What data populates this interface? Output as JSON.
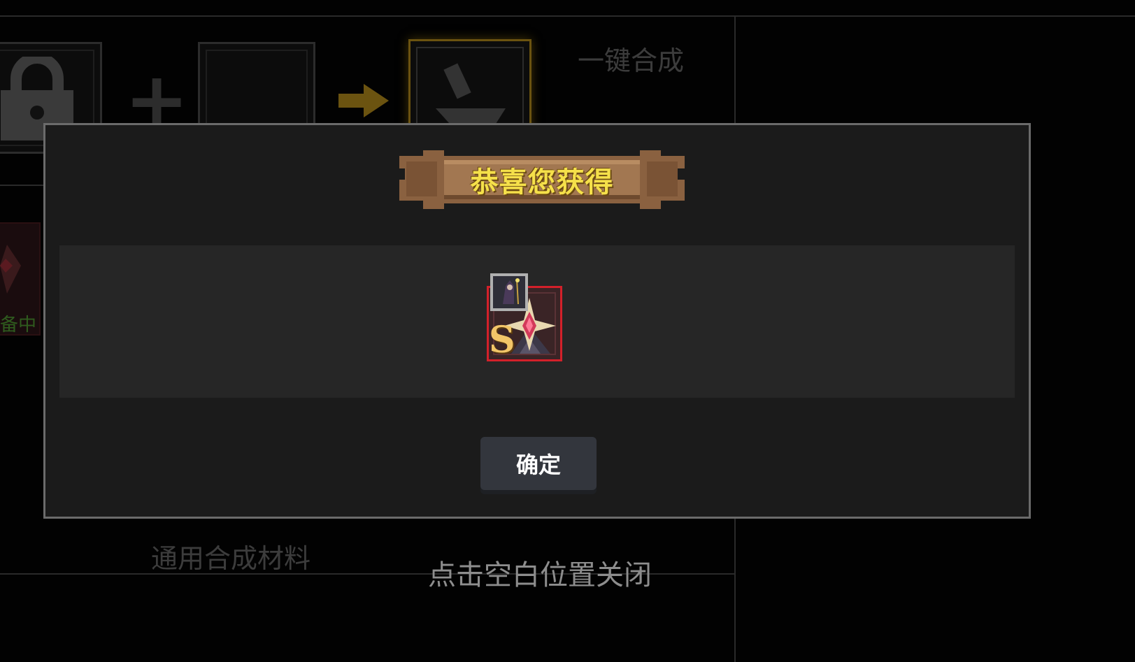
{
  "background": {
    "one_click_label": "一键合成",
    "material_label": "通用合成材料",
    "equipped_label": "备中"
  },
  "modal": {
    "title": "恭喜您获得",
    "reward": {
      "grade": "S",
      "rarity_color": "#d3202a"
    },
    "confirm_label": "确定"
  },
  "close_hint": "点击空白位置关闭",
  "colors": {
    "title_text": "#f5e04a",
    "modal_border": "#6b6b6b",
    "modal_bg": "#1b1b1b",
    "button_bg": "#33363d",
    "arrow": "#6b5310"
  },
  "icons": [
    "lock-icon",
    "plus-icon",
    "arrow-right-icon",
    "anvil-icon",
    "gem-icon",
    "character-icon"
  ]
}
